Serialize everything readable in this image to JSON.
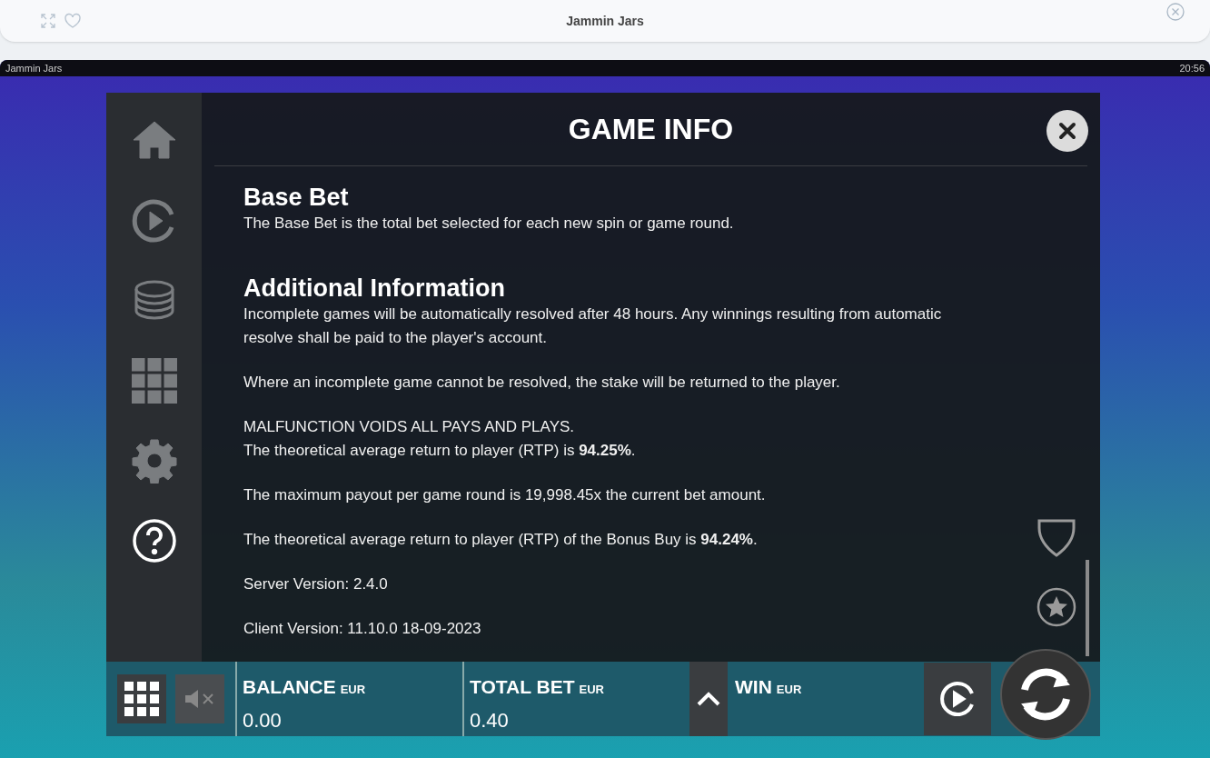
{
  "browser_bar": {
    "title": "Jammin Jars"
  },
  "game_header": {
    "title": "Jammin Jars",
    "clock": "20:56"
  },
  "menu": {
    "items": [
      {
        "kind": "home",
        "selected": false
      },
      {
        "kind": "autoplay",
        "selected": false
      },
      {
        "kind": "coins",
        "selected": false
      },
      {
        "kind": "grid",
        "selected": false
      },
      {
        "kind": "settings",
        "selected": false
      },
      {
        "kind": "help",
        "selected": true
      }
    ]
  },
  "info": {
    "title": "GAME INFO",
    "sections": [
      {
        "heading": "Base Bet",
        "paragraphs": [
          [
            "The Base Bet is the total bet selected for each new spin or game round."
          ]
        ]
      },
      {
        "heading": "Additional Information",
        "paragraphs": [
          [
            "Incomplete games will be automatically resolved after 48 hours. Any winnings resulting from automatic resolve shall be paid to the player's account."
          ],
          [
            "Where an incomplete game cannot be resolved, the stake will be returned to the player."
          ],
          [
            "MALFUNCTION VOIDS ALL PAYS AND PLAYS.",
            "The theoretical average return to player (RTP) is **94.25%**."
          ],
          [
            "The maximum payout per game round is 19,998.45x the current bet amount."
          ],
          [
            "The theoretical average return to player (RTP) of the Bonus Buy is **94.24%**."
          ],
          [
            "Server Version: 2.4.0"
          ],
          [
            "Client Version: 11.10.0 18-09-2023"
          ]
        ]
      }
    ]
  },
  "bottom_bar": {
    "fields": [
      {
        "label": "BALANCE",
        "currency": "EUR",
        "value": "0.00"
      },
      {
        "label": "TOTAL BET",
        "currency": "EUR",
        "value": "0.40"
      },
      {
        "label": "WIN",
        "currency": "EUR"
      }
    ]
  }
}
